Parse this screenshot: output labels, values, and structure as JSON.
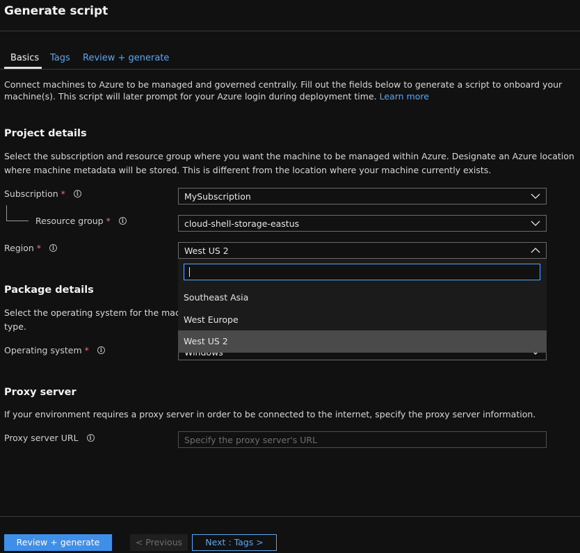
{
  "header": {
    "title": "Generate script"
  },
  "tabs": [
    {
      "label": "Basics",
      "active": true
    },
    {
      "label": "Tags",
      "active": false
    },
    {
      "label": "Review + generate",
      "active": false
    }
  ],
  "intro": {
    "line1": "Connect machines to Azure to be managed and governed centrally. Fill out the fields below to generate a script to onboard your",
    "line2": "machine(s). This script will later prompt for your Azure login during deployment time.",
    "learn_more": "Learn more"
  },
  "project": {
    "heading": "Project details",
    "line1": "Select the subscription and resource group where you want the machine to be managed within Azure. Designate an Azure location",
    "line2": "where machine metadata will be stored. This is different from the location where your machine currently exists.",
    "subscription": {
      "label": "Subscription",
      "value": "MySubscription"
    },
    "resource_group": {
      "label": "Resource group",
      "value": "cloud-shell-storage-eastus"
    },
    "region": {
      "label": "Region",
      "value": "West US 2"
    }
  },
  "region_dropdown": {
    "search_value": "",
    "options": [
      "Southeast Asia",
      "West Europe",
      "West US 2"
    ],
    "selected": "West US 2"
  },
  "package": {
    "heading": "Package details",
    "line1": "Select the operating system for the machin",
    "line2": "type.",
    "os": {
      "label": "Operating system",
      "value": "Windows"
    }
  },
  "proxy": {
    "heading": "Proxy server",
    "line1": "If your environment requires a proxy server in order to be connected to the internet, specify the proxy server information.",
    "url": {
      "label": "Proxy server URL",
      "placeholder": "Specify the proxy server's URL"
    }
  },
  "required_marker": "*",
  "info_glyph": "i",
  "footer": {
    "primary": "Review + generate",
    "previous": "< Previous",
    "next": "Next : Tags >"
  },
  "colors": {
    "accent": "#3f8ee8",
    "link": "#59a7f2",
    "required": "#f1707b",
    "background": "#111111"
  }
}
